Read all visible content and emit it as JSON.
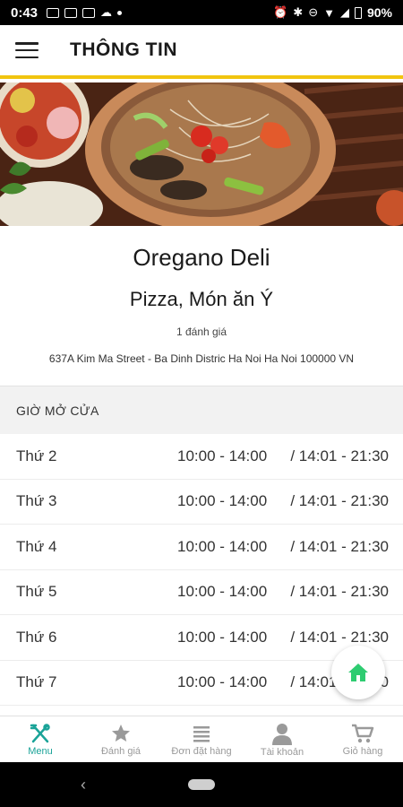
{
  "status_bar": {
    "time": "0:43",
    "battery": "90%"
  },
  "app_bar": {
    "title": "THÔNG TIN"
  },
  "restaurant": {
    "name": "Oregano Deli",
    "cuisine": "Pizza, Món ăn Ý",
    "rating": "1 đánh giá",
    "address": "637A Kim Ma Street - Ba Dinh Distric Ha Noi Ha Noi 100000 VN"
  },
  "hours": {
    "header": "GIỜ MỞ CỬA",
    "rows": [
      {
        "day": "Thứ 2",
        "slot1": "10:00 - 14:00",
        "slot2": "/ 14:01 - 21:30"
      },
      {
        "day": "Thứ 3",
        "slot1": "10:00 - 14:00",
        "slot2": "/ 14:01 - 21:30"
      },
      {
        "day": "Thứ 4",
        "slot1": "10:00 - 14:00",
        "slot2": "/ 14:01 - 21:30"
      },
      {
        "day": "Thứ 5",
        "slot1": "10:00 - 14:00",
        "slot2": "/ 14:01 - 21:30"
      },
      {
        "day": "Thứ 6",
        "slot1": "10:00 - 14:00",
        "slot2": "/ 14:01 - 21:30"
      },
      {
        "day": "Thứ 7",
        "slot1": "10:00 - 14:00",
        "slot2": "/ 14:01 - 21:30"
      }
    ]
  },
  "bottom_nav": {
    "items": [
      {
        "label": "Menu",
        "icon": "fork-knife-icon"
      },
      {
        "label": "Đánh giá",
        "icon": "star-icon"
      },
      {
        "label": "Đơn đặt hàng",
        "icon": "list-icon"
      },
      {
        "label": "Tài khoản",
        "icon": "user-icon"
      },
      {
        "label": "Giỏ hàng",
        "icon": "cart-icon"
      }
    ]
  },
  "colors": {
    "accent_yellow": "#f1c40f",
    "active_teal": "#1aa398",
    "home_green": "#2ecc71"
  }
}
